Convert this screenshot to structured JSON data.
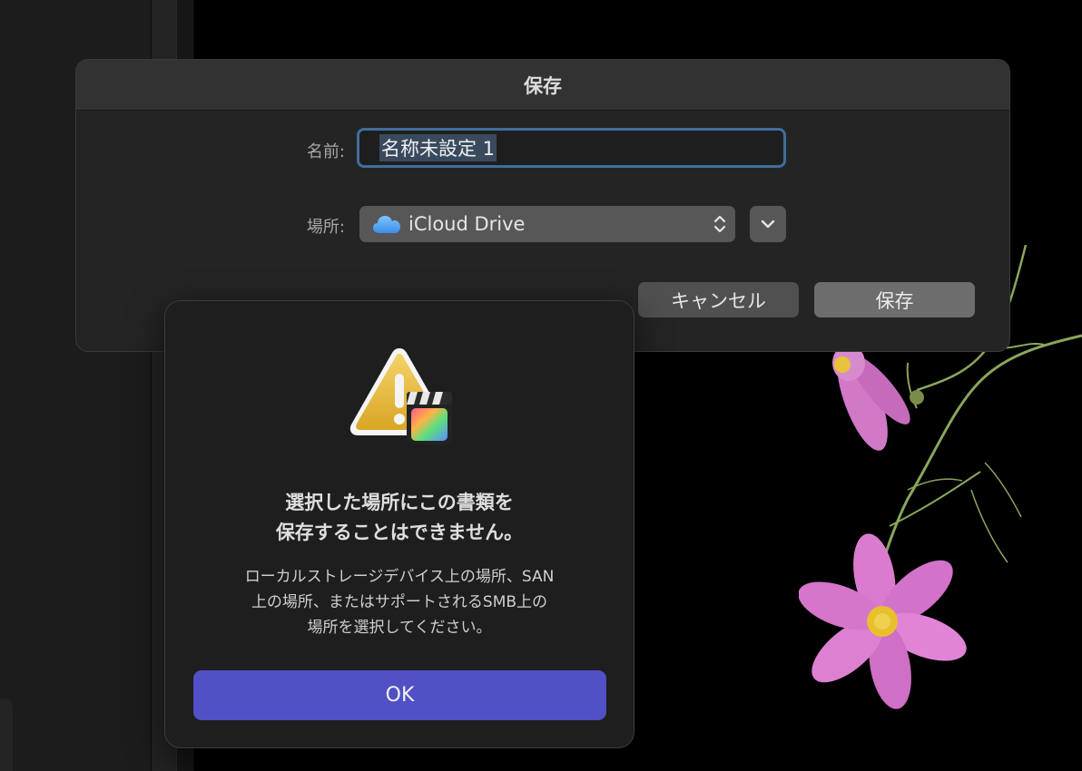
{
  "save_sheet": {
    "title": "保存",
    "name_label": "名前:",
    "name_value": "名称未設定 1",
    "location_label": "場所:",
    "location_value": "iCloud Drive",
    "location_icon": "icloud-icon",
    "cancel_label": "キャンセル",
    "save_label": "保存"
  },
  "alert": {
    "icon": "warning-final-cut-pro-icon",
    "title_line1": "選択した場所にこの書類を",
    "title_line2": "保存することはできません。",
    "message_line1": "ローカルストレージデバイス上の場所、SAN",
    "message_line2": "上の場所、またはサポートされるSMB上の",
    "message_line3": "場所を選択してください。",
    "ok_label": "OK"
  },
  "colors": {
    "accent_button": "#5150c4",
    "focus_ring": "#3f6e9b",
    "sheet_bg": "#242424",
    "alert_bg": "#1e1e1e"
  }
}
